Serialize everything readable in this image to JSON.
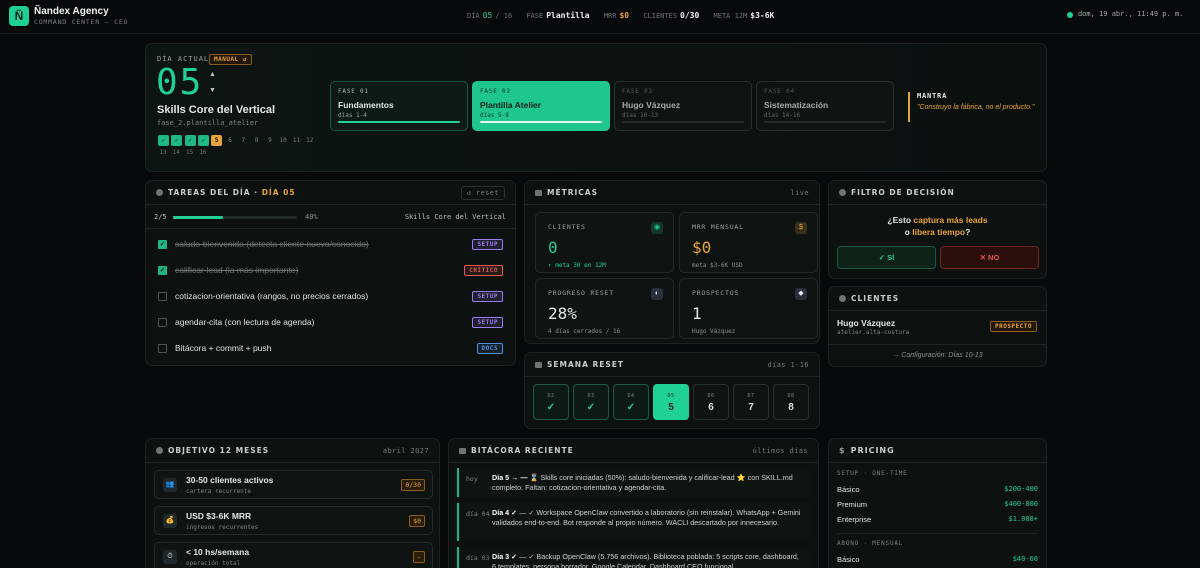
{
  "header": {
    "logo_letter": "Ñ",
    "brand": "Ñandex Agency",
    "subtitle": "COMMAND CENTER — CEO",
    "dia_label": "DÍA",
    "dia_value": "05",
    "dia_total": "/ 16",
    "fase_label": "FASE",
    "fase_value": "Plantilla",
    "mrr_label": "MRR",
    "mrr_value": "$0",
    "clientes_label": "CLIENTES",
    "clientes_value": "0/30",
    "meta_label": "META 12M",
    "meta_value": "$3-6K",
    "clock": "dom, 19 abr., 11:49 p. m."
  },
  "hero": {
    "label": "DÍA ACTUAL",
    "mode_badge": "MANUAL ↺",
    "day_number": "05",
    "up": "▲",
    "down": "▼",
    "title": "Skills Core del Vertical",
    "slug": "fase_2.plantilla_atelier",
    "day_chips": [
      {
        "label": "✓",
        "state": "done"
      },
      {
        "label": "✓",
        "state": "done"
      },
      {
        "label": "✓",
        "state": "done"
      },
      {
        "label": "✓",
        "state": "done"
      },
      {
        "label": "5",
        "state": "cur"
      },
      {
        "label": "6",
        "state": "todo"
      },
      {
        "label": "7",
        "state": "todo"
      },
      {
        "label": "8",
        "state": "todo"
      },
      {
        "label": "9",
        "state": "todo"
      },
      {
        "label": "10",
        "state": "todo"
      },
      {
        "label": "11",
        "state": "todo"
      },
      {
        "label": "12",
        "state": "todo"
      }
    ],
    "day_chips_row2": [
      "13",
      "14",
      "15",
      "16"
    ],
    "phases": [
      {
        "label": "FASE 01",
        "title": "Fundamentos",
        "days": "días 1-4",
        "progress": 1.0,
        "state": "done"
      },
      {
        "label": "FASE 02",
        "title": "Plantilla Atelier",
        "days": "días 5-9",
        "progress": 1.0,
        "state": "active"
      },
      {
        "label": "FASE 03",
        "title": "Hugo Vázquez",
        "days": "días 10-13",
        "progress": 0,
        "state": "todo"
      },
      {
        "label": "FASE 04",
        "title": "Sistematización",
        "days": "días 14-16",
        "progress": 0,
        "state": "todo"
      }
    ],
    "mantra_label": "MANTRA",
    "mantra_text": "\"Construyo la fábrica, no el producto.\""
  },
  "tasks": {
    "title": "TAREAS DEL DÍA ·",
    "title_day": "DÍA 05",
    "reset": "↺ reset",
    "count": "2/5",
    "progress": 0.4,
    "percent": "40%",
    "context": "Skills Core del Vertical",
    "items": [
      {
        "text": "saludo-bienvenida (detecta cliente nuevo/conocido)",
        "done": true,
        "tag": "SETUP",
        "tag_color": "#9b7cf2"
      },
      {
        "text": "calificar-lead (la más importante)",
        "done": true,
        "tag": "CRÍTICO",
        "tag_color": "#e25b52"
      },
      {
        "text": "cotizacion-orientativa (rangos, no precios cerrados)",
        "done": false,
        "tag": "SETUP",
        "tag_color": "#9b7cf2"
      },
      {
        "text": "agendar-cita (con lectura de agenda)",
        "done": false,
        "tag": "SETUP",
        "tag_color": "#9b7cf2"
      },
      {
        "text": "Bitácora + commit + push",
        "done": false,
        "tag": "DOCS",
        "tag_color": "#4f8fe0"
      }
    ]
  },
  "metrics": {
    "title": "MÉTRICAS",
    "live": "live",
    "boxes": [
      {
        "label": "CLIENTES",
        "value": "0",
        "sub": "↑ meta 30 en 12M",
        "icon": "◉",
        "color": "#1fd195"
      },
      {
        "label": "MRR MENSUAL",
        "value": "$0",
        "sub": "meta $3-6K USD",
        "icon": "$",
        "color": "#e8a43c"
      },
      {
        "label": "PROGRESO RESET",
        "value": "28%",
        "sub": "4 días cerrados / 16",
        "icon": "◐",
        "color": "#e3e7e4"
      },
      {
        "label": "PROSPECTOS",
        "value": "1",
        "sub": "Hugo Vázquez",
        "icon": "◆",
        "color": "#e3e7e4"
      }
    ]
  },
  "week": {
    "title": "SEMANA RESET",
    "range": "días 1-16",
    "days": [
      {
        "label": "D2",
        "value": "✓",
        "state": "done"
      },
      {
        "label": "D3",
        "value": "✓",
        "state": "done"
      },
      {
        "label": "D4",
        "value": "✓",
        "state": "done"
      },
      {
        "label": "D5",
        "value": "5",
        "state": "cur"
      },
      {
        "label": "D6",
        "value": "6",
        "state": "todo"
      },
      {
        "label": "D7",
        "value": "7",
        "state": "todo"
      },
      {
        "label": "D8",
        "value": "8",
        "state": "todo"
      }
    ]
  },
  "decision": {
    "title": "FILTRO DE DECISIÓN",
    "q1": "¿Esto ",
    "q_hl1": "captura más leads",
    "q2": "o ",
    "q_hl2": "libera tiempo",
    "q3": "?",
    "yes": "✓ SÍ",
    "no": "✕ NO"
  },
  "clients": {
    "title": "CLIENTES",
    "name": "Hugo Vázquez",
    "handle": "atelier.alta-costura",
    "badge": "PROSPECTO",
    "note": "→ Configuración: Días 10-13"
  },
  "objective": {
    "title": "OBJETIVO 12 MESES",
    "date": "abril 2027",
    "items": [
      {
        "icon": "👥",
        "title": "30-50 clientes activos",
        "sub": "cartera recurrente",
        "badge": "0/30"
      },
      {
        "icon": "💰",
        "title": "USD $3-6K MRR",
        "sub": "ingresos recurrentes",
        "badge": "$0"
      },
      {
        "icon": "⏱",
        "title": "< 10 hs/semana",
        "sub": "operación total",
        "badge": "-"
      }
    ]
  },
  "log": {
    "title": "BITÁCORA RECIENTE",
    "range": "últimos días",
    "entries": [
      {
        "date": "hoy",
        "head": "Día 5 → —",
        "text": " ⌛ Skills core iniciadas (50%): saludo-bienvenida y calificar-lead ⭐ con SKILL.md completo. Faltan: cotizacion-orientativa y agendar-cita."
      },
      {
        "date": "día 04",
        "head": "Día 4 ✓",
        "text": " — ✓ Workspace OpenClaw convertido a laboratorio (sin reinstalar). WhatsApp + Gemini validados end-to-end. Bot responde al propio número. WACLI descartado por innecesario."
      },
      {
        "date": "día 03",
        "head": "Día 3 ✓",
        "text": " — ✓ Backup OpenClaw (5.756 archivos). Biblioteca poblada: 5 scripts core, dashboard, 6 templates, persona borrador. Google Calendar. Dashboard CEO funcional."
      }
    ]
  },
  "pricing": {
    "title": "PRICING",
    "setup_label": "SETUP · ONE-TIME",
    "setup": [
      {
        "name": "Básico",
        "price": "$200-400"
      },
      {
        "name": "Premium",
        "price": "$400-800"
      },
      {
        "name": "Enterprise",
        "price": "$1.000+"
      }
    ],
    "abono_label": "ABONO · MENSUAL",
    "abono": [
      {
        "name": "Básico",
        "price": "$40-60"
      }
    ]
  }
}
